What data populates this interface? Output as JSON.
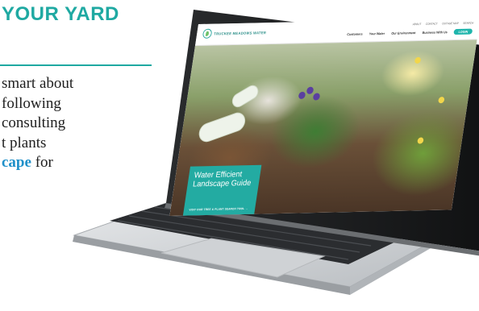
{
  "article": {
    "headline": "YOUR YARD",
    "paragraph_lines": [
      "smart about",
      "following",
      "consulting",
      "t plants"
    ],
    "last_line_link": "cape",
    "last_line_tail": " for"
  },
  "website": {
    "logo_text": "TRUCKEE MEADOWS WATER",
    "util_links": [
      "ABOUT",
      "CONTACT",
      "OUTAGE MAP",
      "SEARCH"
    ],
    "nav": [
      "Customers",
      "Your Water",
      "Our Environment",
      "Business With Us"
    ],
    "login_label": "LOGIN",
    "hero_title": "Water Efficient Landscape Guide",
    "hero_link": "VISIT OUR TREE & PLANT SEARCH TOOL  →"
  },
  "colors": {
    "accent_teal": "#1fa9a2",
    "link_blue": "#1f90c9",
    "laptop_silver": "#d3d6d9"
  }
}
